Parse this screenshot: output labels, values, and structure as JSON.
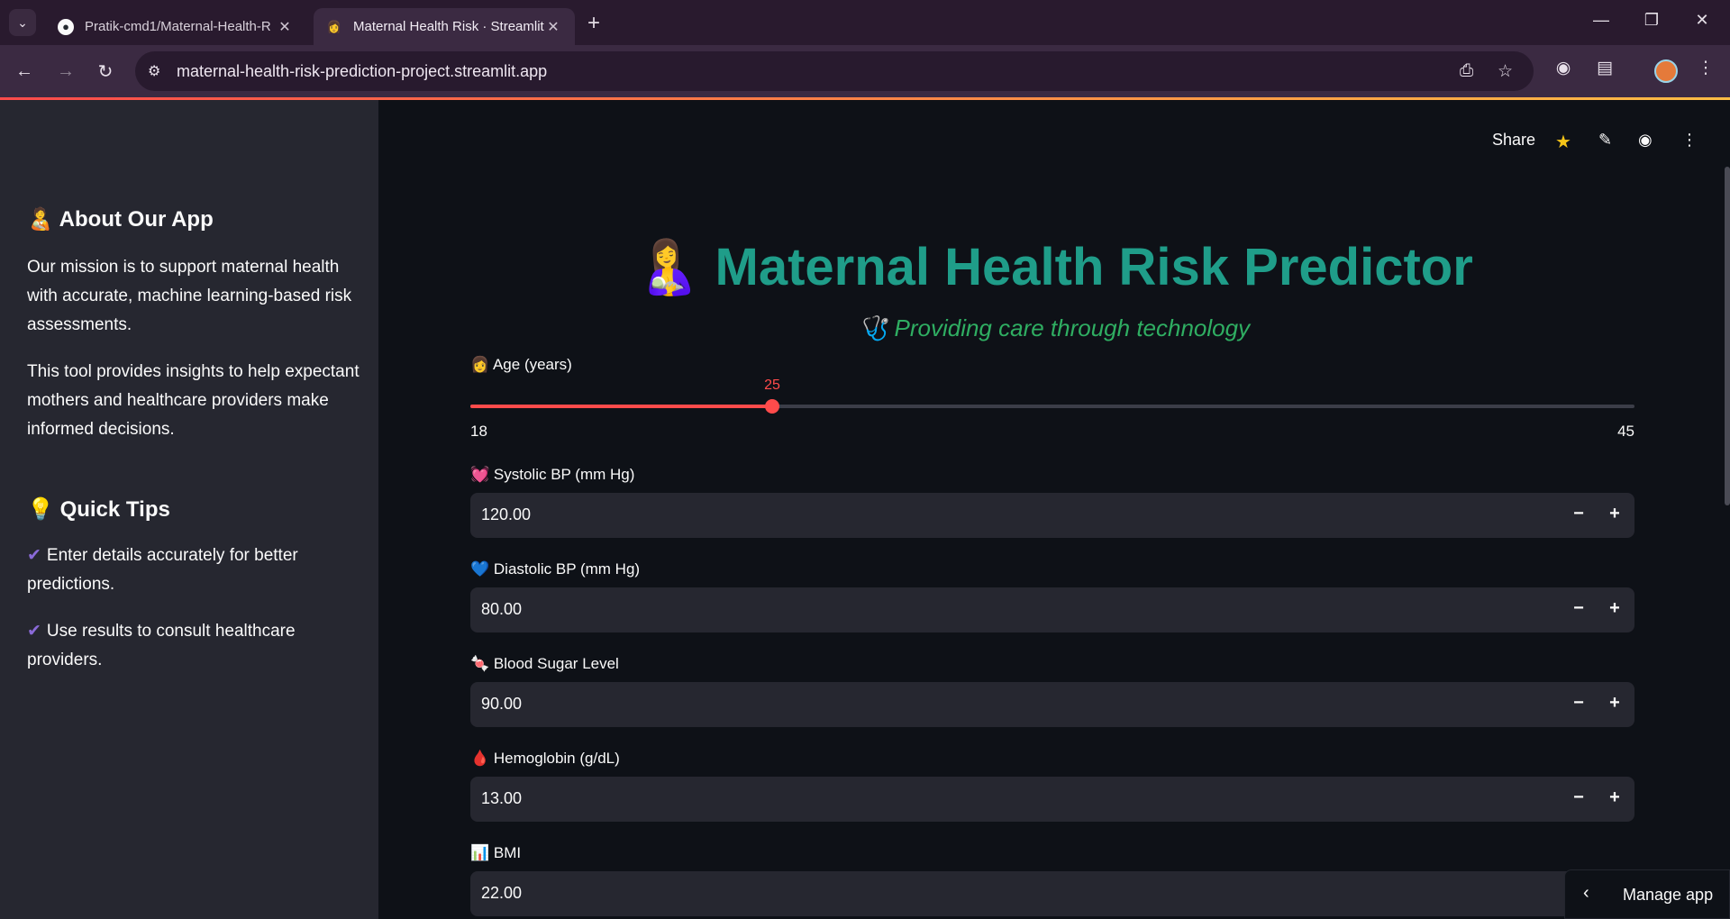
{
  "browser": {
    "tabs": [
      {
        "label": "Pratik-cmd1/Maternal-Health-R",
        "icon": "github-icon"
      },
      {
        "label": "Maternal Health Risk · Streamlit",
        "icon": "woman-emoji-icon"
      }
    ],
    "url": "maternal-health-risk-prediction-project.streamlit.app"
  },
  "sidebar": {
    "about_heading": "About Our App",
    "about_emoji": "🧑‍🍼",
    "about_para1": "Our mission is to support maternal health with accurate, machine learning-based risk assessments.",
    "about_para2": "This tool provides insights to help expectant mothers and healthcare providers make informed decisions.",
    "tips_heading": "Quick Tips",
    "tips_emoji": "💡",
    "tips": [
      "Enter details accurately for better predictions.",
      "Use results to consult healthcare providers."
    ]
  },
  "header": {
    "share_label": "Share"
  },
  "main": {
    "title": "Maternal Health Risk Predictor",
    "title_emoji": "🤱",
    "subtitle": "Providing care through technology",
    "subtitle_emoji": "🩺",
    "age": {
      "label": "Age (years)",
      "emoji": "👩",
      "value": "25",
      "min": "18",
      "max": "45",
      "fraction": 0.2593
    },
    "fields": [
      {
        "label": "Systolic BP (mm Hg)",
        "emoji": "💓",
        "value": "120.00"
      },
      {
        "label": "Diastolic BP (mm Hg)",
        "emoji": "💙",
        "value": "80.00"
      },
      {
        "label": "Blood Sugar Level",
        "emoji": "🍬",
        "value": "90.00"
      },
      {
        "label": "Hemoglobin (g/dL)",
        "emoji": "🩸",
        "value": "13.00"
      },
      {
        "label": "BMI",
        "emoji": "📊",
        "value": "22.00"
      }
    ]
  },
  "manage_app_label": "Manage app",
  "colors": {
    "accent": "#ff4b4b",
    "title": "#1f9d89",
    "subtitle": "#2fae62",
    "background": "#0e1117",
    "sidebar": "#262730"
  }
}
